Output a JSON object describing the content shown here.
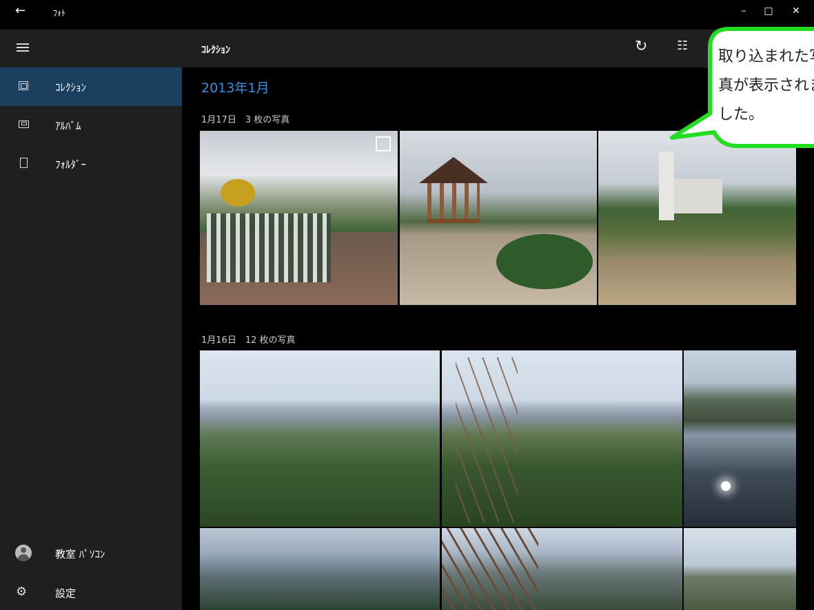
{
  "titlebar": {
    "back": "←",
    "title": "ﾌｫﾄ",
    "minimize": "–",
    "maximize": "□",
    "close": "✕"
  },
  "sidebar": {
    "items": [
      {
        "label": "ｺﾚｸｼｮﾝ",
        "icon": "collection-icon",
        "active": true
      },
      {
        "label": "ｱﾙﾊﾞﾑ",
        "icon": "album-icon",
        "active": false
      },
      {
        "label": "ﾌｫﾙﾀﾞｰ",
        "icon": "folder-icon",
        "active": false
      }
    ],
    "user": "教室 ﾊﾟｿｺﾝ",
    "settings": "設定"
  },
  "header": {
    "title": "ｺﾚｸｼｮﾝ",
    "refresh_icon": "↻",
    "select_icon": "☷"
  },
  "content": {
    "month": "2013年1月",
    "groups": [
      {
        "label": "1月17日　3 枚の写真"
      },
      {
        "label": "1月16日　12 枚の写真"
      }
    ]
  },
  "callout": {
    "lines": [
      "取り込まれた写",
      "真が表示されま",
      "した。"
    ],
    "border_color": "#22dd22"
  },
  "colors": {
    "accent": "#3c8fe0",
    "sidebar_active": "#1b3f5e",
    "sidebar_bg": "#1f1f1f"
  }
}
